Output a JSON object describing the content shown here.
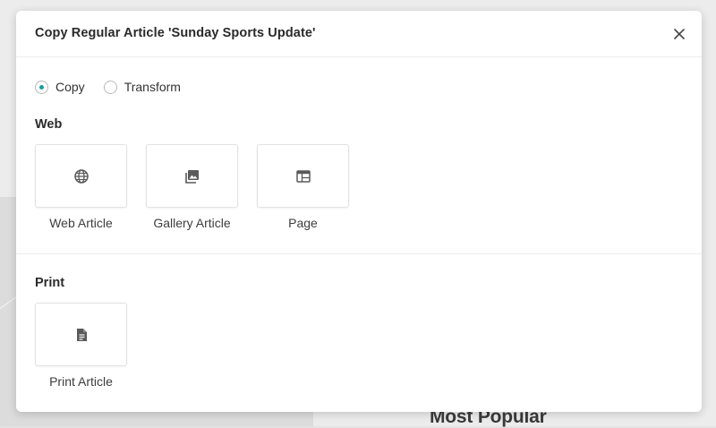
{
  "background": {
    "heading": "Most Popular"
  },
  "modal": {
    "title": "Copy Regular Article 'Sunday Sports Update'",
    "close_icon": "close-icon",
    "mode_options": [
      {
        "label": "Copy",
        "selected": true
      },
      {
        "label": "Transform",
        "selected": false
      }
    ],
    "accent_color": "#1a9c9c",
    "sections": {
      "web": {
        "title": "Web",
        "cards": [
          {
            "label": "Web Article",
            "icon": "globe-icon"
          },
          {
            "label": "Gallery Article",
            "icon": "image-gallery-icon"
          },
          {
            "label": "Page",
            "icon": "page-layout-icon"
          }
        ]
      },
      "print": {
        "title": "Print",
        "cards": [
          {
            "label": "Print Article",
            "icon": "document-icon"
          }
        ]
      }
    }
  }
}
